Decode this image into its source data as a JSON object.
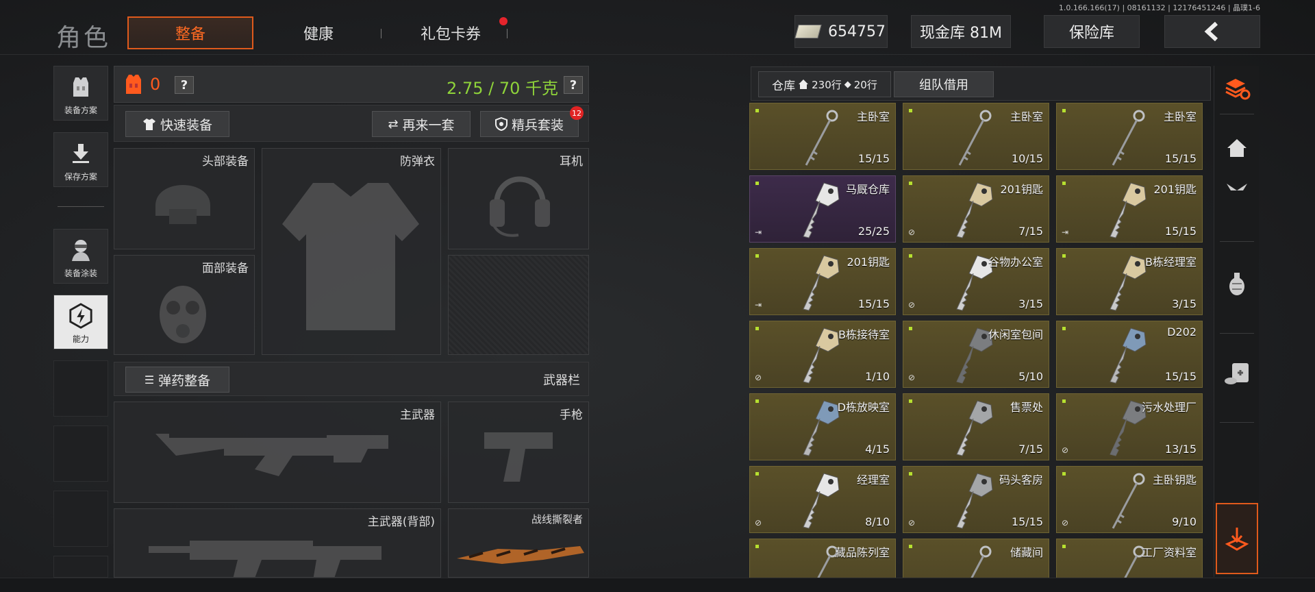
{
  "version": "1.0.166.166(17) | 08161132 | 12176451246 | 晶璞1-6",
  "top": {
    "title": "角色",
    "tabs": [
      "整备",
      "健康",
      "礼包卡券"
    ],
    "cash": "654757",
    "cash_vault": "现金库 81M",
    "insurance": "保险库",
    "back_icon": "chevron-left-icon"
  },
  "sidebar": {
    "items": [
      {
        "label": "装备方案",
        "icon": "vest-icon"
      },
      {
        "label": "保存方案",
        "icon": "download-icon"
      },
      {
        "label": "装备涂装",
        "icon": "operator-icon"
      },
      {
        "label": "能力",
        "icon": "ability-icon"
      }
    ]
  },
  "loadout": {
    "armor_count": "0",
    "help": "?",
    "weight": "2.75 / 70 千克",
    "quick_equip": "快速装备",
    "again": "再来一套",
    "elite": "精兵套装",
    "elite_badge": "12",
    "slots": {
      "head": "头部装备",
      "vest": "防弹衣",
      "earphone": "耳机",
      "face": "面部装备",
      "ammo": "弹药整备",
      "weapon_bar": "武器栏",
      "primary": "主武器",
      "pistol": "手枪",
      "primary_back": "主武器(背部)",
      "melee": "战线撕裂者"
    }
  },
  "storage": {
    "warehouse": "仓库",
    "rows_a": "230行",
    "rows_b": "20行",
    "team_borrow": "组队借用",
    "items": [
      {
        "name": "主卧室",
        "count": "15/15",
        "corner": "",
        "type": "long"
      },
      {
        "name": "主卧室",
        "count": "10/15",
        "corner": "",
        "type": "long"
      },
      {
        "name": "主卧室",
        "count": "15/15",
        "corner": "",
        "type": "long"
      },
      {
        "name": "马厩仓库",
        "count": "25/25",
        "corner": "exit",
        "type": "silver",
        "purple": true
      },
      {
        "name": "201钥匙",
        "count": "7/15",
        "corner": "noentry",
        "type": "brass"
      },
      {
        "name": "201钥匙",
        "count": "15/15",
        "corner": "exit",
        "type": "brass"
      },
      {
        "name": "201钥匙",
        "count": "15/15",
        "corner": "exit",
        "type": "brass"
      },
      {
        "name": "谷物办公室",
        "count": "3/15",
        "corner": "noentry",
        "type": "silver"
      },
      {
        "name": "B栋经理室",
        "count": "3/15",
        "corner": "",
        "type": "brass"
      },
      {
        "name": "B栋接待室",
        "count": "1/10",
        "corner": "noentry",
        "type": "brass"
      },
      {
        "name": "休闲室包间",
        "count": "5/10",
        "corner": "noentry",
        "type": "dark"
      },
      {
        "name": "D202",
        "count": "15/15",
        "corner": "",
        "type": "blue"
      },
      {
        "name": "D栋放映室",
        "count": "4/15",
        "corner": "",
        "type": "blue"
      },
      {
        "name": "售票处",
        "count": "7/15",
        "corner": "",
        "type": "grey"
      },
      {
        "name": "污水处理厂",
        "count": "13/15",
        "corner": "noentry",
        "type": "dark"
      },
      {
        "name": "经理室",
        "count": "8/10",
        "corner": "noentry",
        "type": "silver"
      },
      {
        "name": "码头客房",
        "count": "15/15",
        "corner": "noentry",
        "type": "grey"
      },
      {
        "name": "主卧钥匙",
        "count": "9/10",
        "corner": "noentry",
        "type": "long"
      },
      {
        "name": "藏品陈列室",
        "count": "",
        "corner": "",
        "type": "long"
      },
      {
        "name": "储藏间",
        "count": "",
        "corner": "",
        "type": "long"
      },
      {
        "name": "工厂资料室",
        "count": "",
        "corner": "",
        "type": "long"
      }
    ]
  },
  "rail": [
    "stack-refresh-icon",
    "home-icon",
    "plane-icon",
    "grenade-icon",
    "medkit-icon",
    "hand-drop-icon"
  ],
  "colors": {
    "accent": "#e05a1c",
    "weight_green": "#8fd43a",
    "card_gold": "#5a5029",
    "card_purple": "#3d2b4a"
  }
}
